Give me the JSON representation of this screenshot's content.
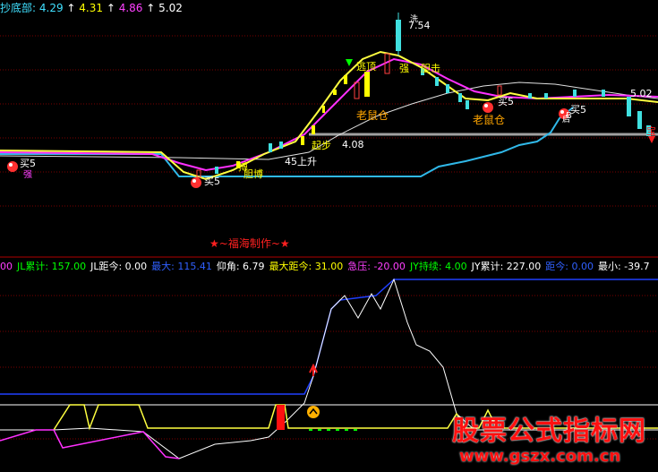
{
  "colors": {
    "background": "#000000",
    "grid": "#8b0000",
    "header_cyan": "#40e0ff",
    "header_yellow": "#ffff00",
    "header_magenta": "#ff40ff",
    "header_white": "#ffffff",
    "header_green": "#00ff00",
    "header_blue": "#3060ff",
    "header_red": "#ff2020",
    "k_up": "#ff4040",
    "k_down": "#40e0e0",
    "label_orange": "#ffa500",
    "signature_red": "#ff2020",
    "watermark_red": "#ff1010"
  },
  "main_panel": {
    "indicator_name": "抄底部",
    "val1": "4.29",
    "val2": "4.31",
    "val3": "4.86",
    "val4": "5.02",
    "price_high": "7.54",
    "price_now": "5.02",
    "price_line": "4.08",
    "labels": {
      "buy_left": "买5",
      "buy_left_sub": "强",
      "buy_mid": "买5",
      "buy_right": "买5",
      "buy_right2": "买5",
      "buy_right2_sub": "B",
      "rat_pos": "老鼠仓",
      "fight": "搏",
      "fight2": "胆博",
      "fight3": "胆击",
      "start": "起步",
      "angle": "45上升",
      "escape": "逃顶",
      "strong": "强",
      "small_label": "洗",
      "red_right": "宝",
      "tiny_right": "启"
    },
    "signature": "★~福海制作~★"
  },
  "sub_panel": {
    "items": [
      {
        "label": "00",
        "color": "#ff40ff"
      },
      {
        "label": "JL累计: 157.00",
        "color": "#00ff00"
      },
      {
        "label": "JL距今: 0.00",
        "color": "#ffffff"
      },
      {
        "label": "最大: 115.41",
        "color": "#3060ff"
      },
      {
        "label": "仰角: 6.79",
        "color": "#ffffff"
      },
      {
        "label": "最大距今: 31.00",
        "color": "#ffff00"
      },
      {
        "label": "急压: -20.00",
        "color": "#ff40ff"
      },
      {
        "label": "JY持续: 4.00",
        "color": "#00ff00"
      },
      {
        "label": "JY累计: 227.00",
        "color": "#ffffff"
      },
      {
        "label": "距今: 0.00",
        "color": "#3060ff"
      },
      {
        "label": "最小: -39.7",
        "color": "#ffffff"
      }
    ]
  },
  "watermark": {
    "title": "股票公式指标网",
    "url": "www.gszx.com.cn"
  }
}
